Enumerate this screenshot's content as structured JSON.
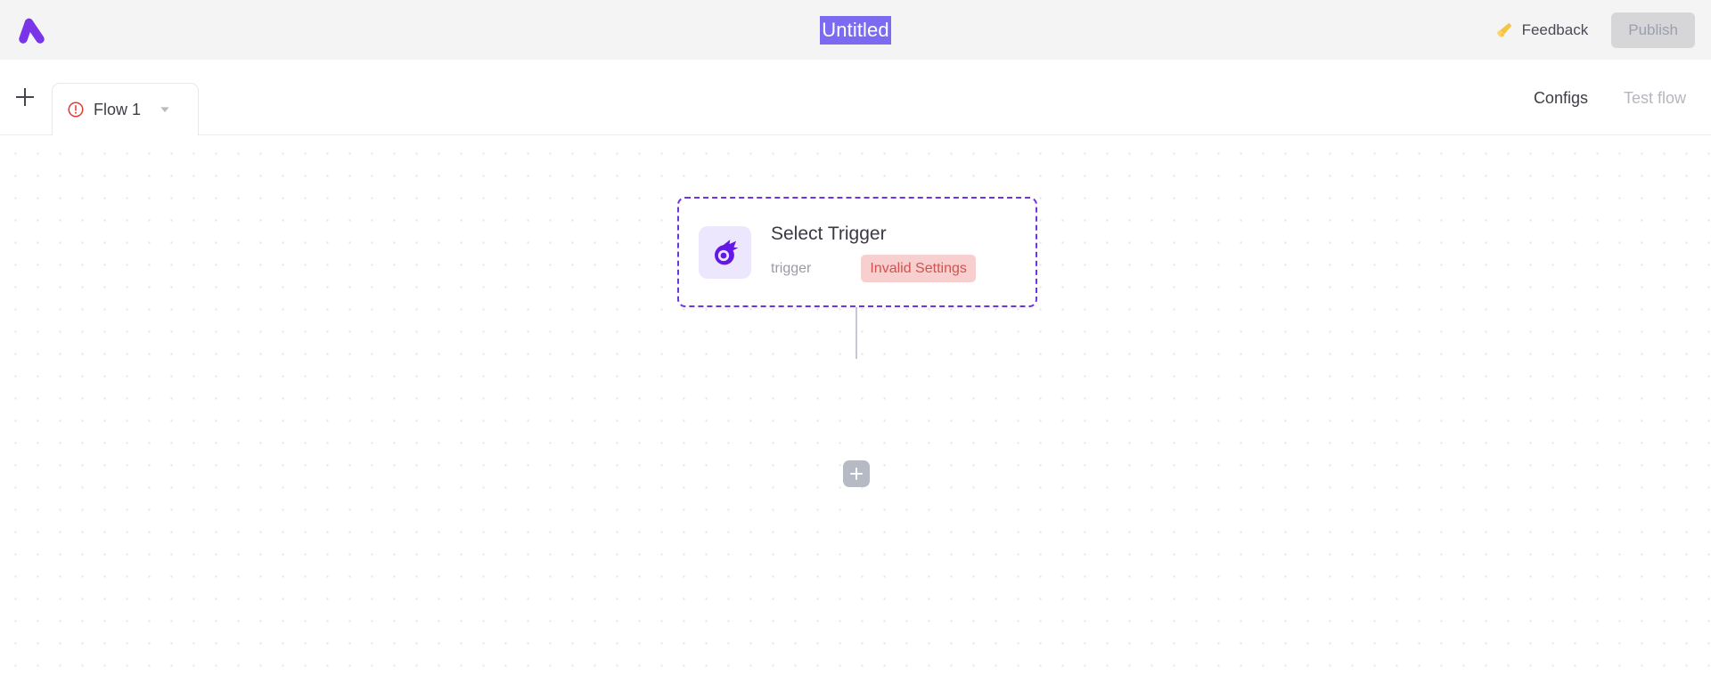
{
  "header": {
    "logo_name": "activepieces-logo",
    "logo_color": "#7a35e8",
    "flow_title": "Untitled",
    "title_selected": true,
    "selection_bg": "#7c6af0",
    "feedback_label": "Feedback",
    "feedback_icon": "megaphone-icon",
    "feedback_icon_color": "#f5c342",
    "publish_label": "Publish",
    "publish_disabled": true
  },
  "tabbar": {
    "add_flow_icon": "plus-icon",
    "tabs": [
      {
        "label": "Flow 1",
        "status_icon": "warning-circle-icon",
        "status_color": "#e03a34",
        "dropdown_icon": "chevron-down-icon",
        "active": true
      }
    ],
    "actions": [
      {
        "label": "Configs",
        "disabled": false
      },
      {
        "label": "Test flow",
        "disabled": true
      }
    ]
  },
  "canvas": {
    "grid": "dot-grid",
    "grid_dot_color": "#e4e4e7",
    "nodes": [
      {
        "title": "Select Trigger",
        "subtitle": "trigger",
        "badge": "Invalid Settings",
        "badge_bg": "#f8cfcf",
        "badge_color": "#d2524f",
        "icon": "comet-icon",
        "icon_color": "#6318e6",
        "icon_bg": "#ede7fd",
        "border_color": "#6d35e0",
        "border_style": "dashed",
        "selected": true
      }
    ],
    "add_step_icon": "plus-icon",
    "connector_color": "#c9c7d4"
  }
}
